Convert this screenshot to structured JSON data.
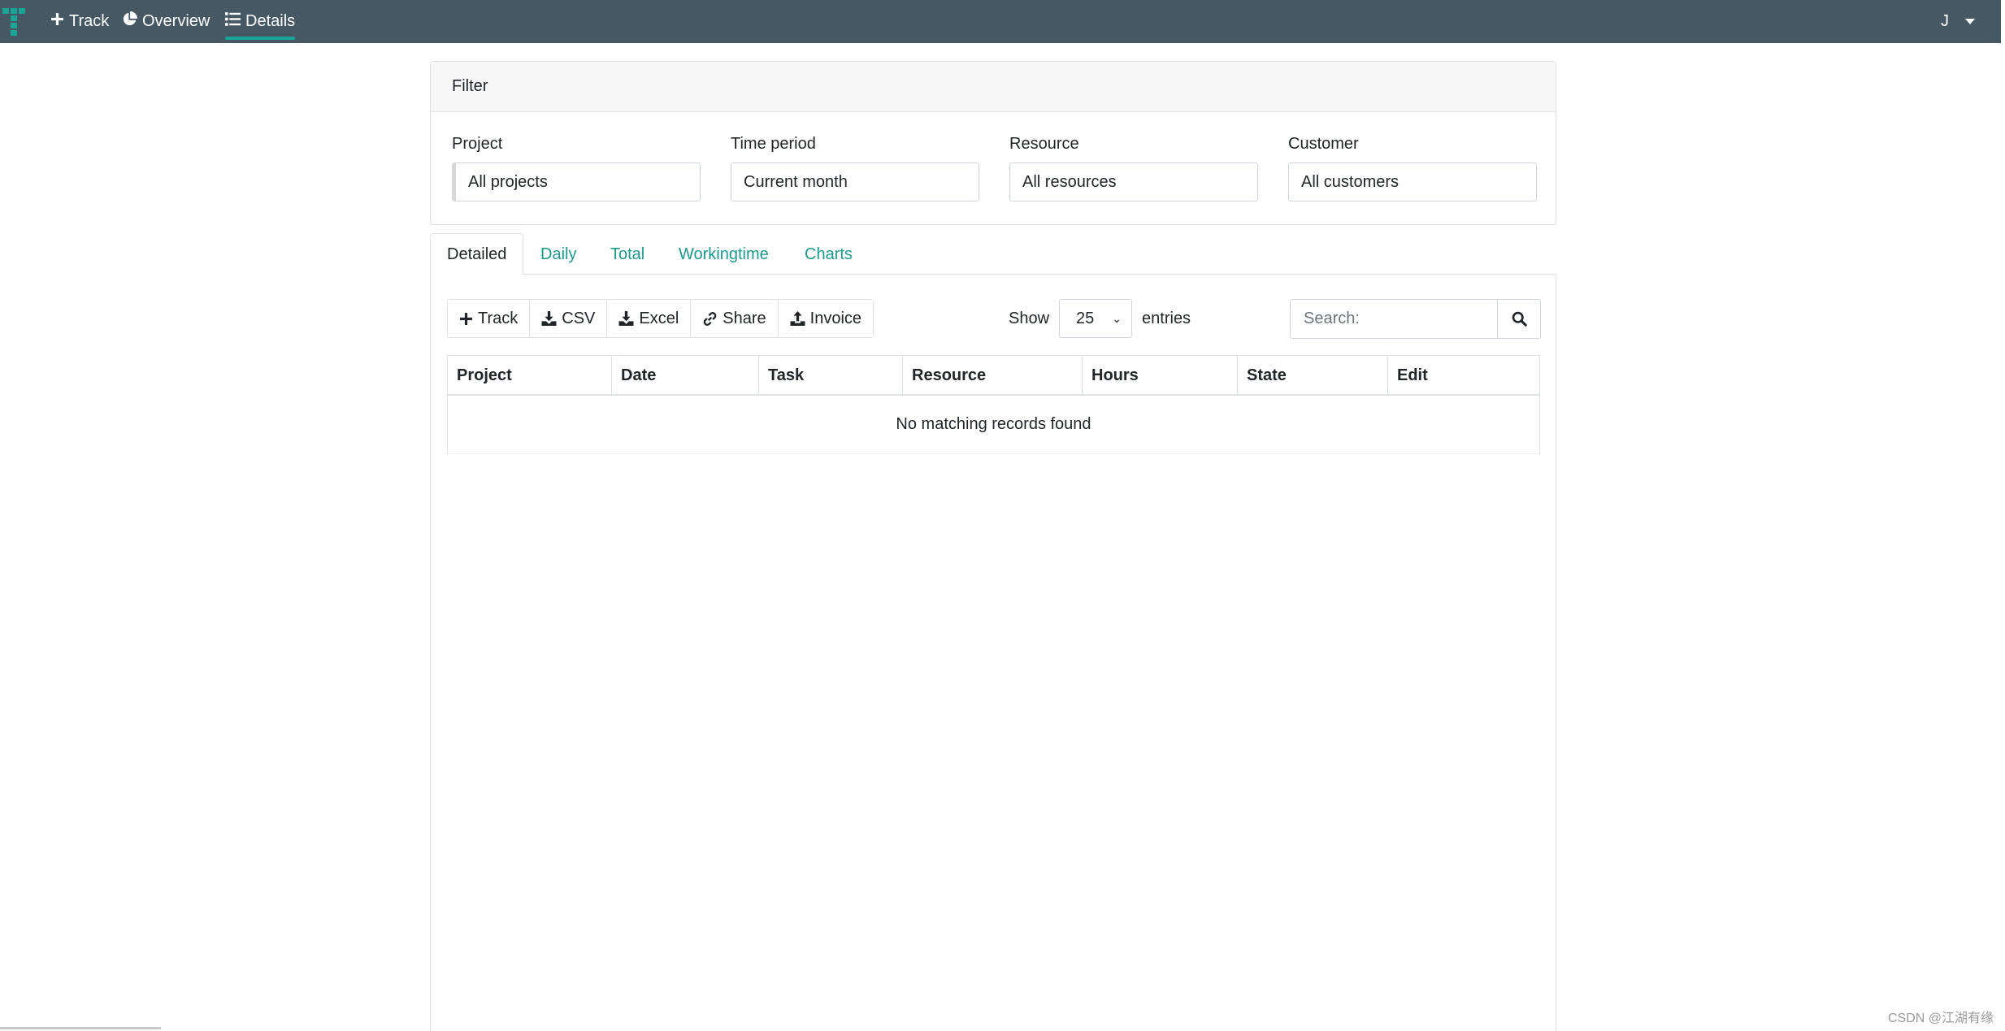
{
  "navbar": {
    "items": [
      {
        "label": "Track",
        "icon": "plus-icon"
      },
      {
        "label": "Overview",
        "icon": "pie-chart-icon"
      },
      {
        "label": "Details",
        "icon": "list-icon",
        "active": true
      }
    ],
    "user_initial": "J",
    "bg_color": "#465863",
    "accent_color": "#1aa598"
  },
  "filter": {
    "title": "Filter",
    "fields": [
      {
        "label": "Project",
        "value": "All projects"
      },
      {
        "label": "Time period",
        "value": "Current month"
      },
      {
        "label": "Resource",
        "value": "All resources"
      },
      {
        "label": "Customer",
        "value": "All customers"
      }
    ]
  },
  "tabs": [
    {
      "label": "Detailed",
      "active": true
    },
    {
      "label": "Daily"
    },
    {
      "label": "Total"
    },
    {
      "label": "Workingtime"
    },
    {
      "label": "Charts"
    }
  ],
  "toolbar": {
    "buttons": [
      {
        "label": "Track",
        "icon": "plus-icon"
      },
      {
        "label": "CSV",
        "icon": "download-icon"
      },
      {
        "label": "Excel",
        "icon": "download-icon"
      },
      {
        "label": "Share",
        "icon": "link-icon"
      },
      {
        "label": "Invoice",
        "icon": "upload-icon"
      }
    ]
  },
  "length": {
    "show_label": "Show",
    "value": "25",
    "entries_label": "entries"
  },
  "search": {
    "placeholder": "Search:"
  },
  "table": {
    "columns": [
      "Project",
      "Date",
      "Task",
      "Resource",
      "Hours",
      "State",
      "Edit"
    ],
    "empty_message": "No matching records found"
  },
  "watermark": "CSDN @江湖有缘"
}
